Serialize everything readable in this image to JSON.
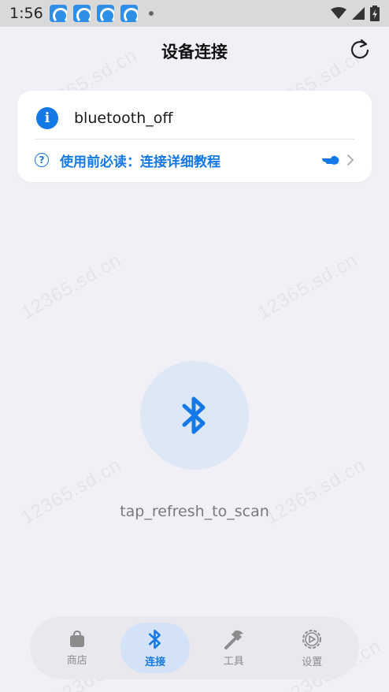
{
  "status_bar": {
    "time": "1:56",
    "notification_icons": [
      "app-notification-icon",
      "app-notification-icon",
      "app-notification-icon",
      "app-notification-icon"
    ]
  },
  "header": {
    "title": "设备连接",
    "refresh_icon": "refresh-icon"
  },
  "watermark_text": "12365.sd.cn",
  "info_card": {
    "status_text": "bluetooth_off",
    "tutorial_text": "使用前必读：连接详细教程"
  },
  "center": {
    "bluetooth_icon": "bluetooth-icon",
    "scan_hint": "tap_refresh_to_scan"
  },
  "bottom_nav": {
    "items": [
      {
        "label": "商店",
        "icon": "shop-bag-icon",
        "active": false
      },
      {
        "label": "连接",
        "icon": "bluetooth-icon",
        "active": true
      },
      {
        "label": "工具",
        "icon": "hammer-icon",
        "active": false
      },
      {
        "label": "设置",
        "icon": "settings-icon",
        "active": false
      }
    ]
  },
  "colors": {
    "accent": "#1478e6",
    "background": "#f1f0f6",
    "bt_circle": "#dde7f5",
    "nav_bg": "#e9e8ee",
    "nav_active": "#d3e2f7"
  }
}
